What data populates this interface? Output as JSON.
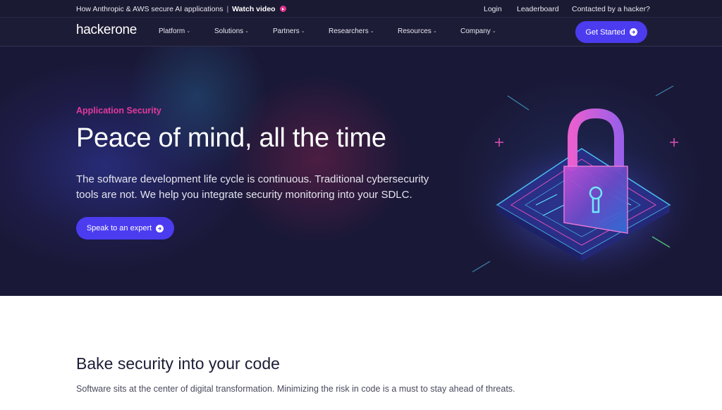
{
  "topbar": {
    "promo_text": "How Anthropic & AWS secure AI applications",
    "separator": "|",
    "watch_label": "Watch video",
    "links": [
      "Login",
      "Leaderboard",
      "Contacted by a hacker?"
    ]
  },
  "nav": {
    "logo_text": "hackerone",
    "items": [
      "Platform",
      "Solutions",
      "Partners",
      "Researchers",
      "Resources",
      "Company"
    ],
    "cta_label": "Get Started"
  },
  "hero": {
    "eyebrow": "Application Security",
    "title": "Peace of mind, all the time",
    "body": "The software development life cycle is continuous. Traditional cybersecurity tools are not. We help you integrate security monitoring into your SDLC.",
    "cta_label": "Speak to an expert"
  },
  "section": {
    "title": "Bake security into your code",
    "body": "Software sits at the center of digital transformation. Minimizing the risk in code is a must to stay ahead of threats."
  },
  "colors": {
    "nav_bg": "#1d1c36",
    "hero_bg": "#1a1837",
    "accent_button": "#4b3cf0",
    "eyebrow_pink": "#e23a9b"
  },
  "icons": {
    "play": "play-circle-icon",
    "arrow": "arrow-right-circle-icon",
    "chevron": "chevron-down-icon",
    "lock": "padlock-illustration"
  }
}
